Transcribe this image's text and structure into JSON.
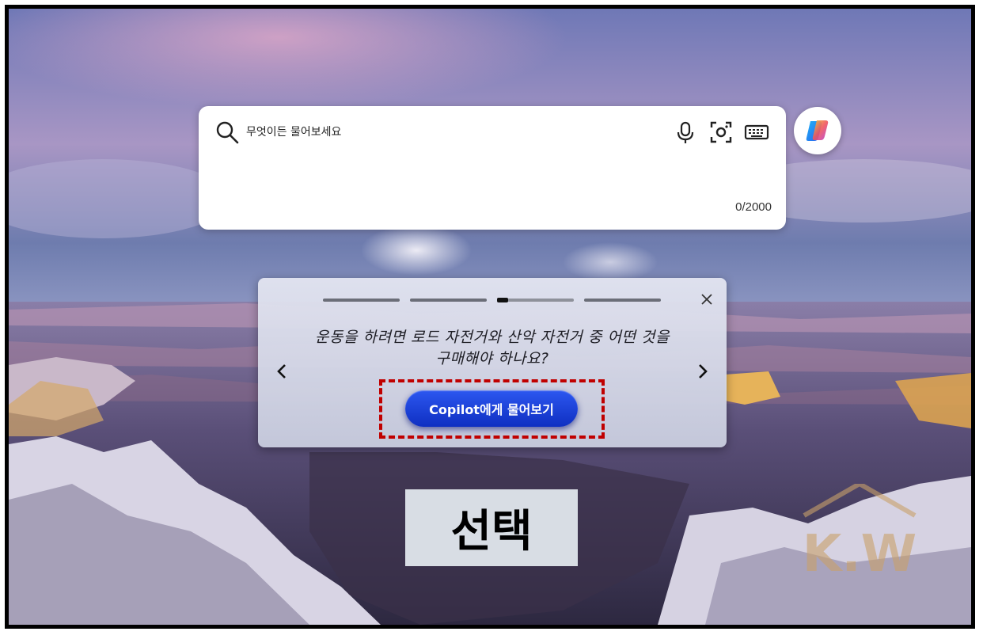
{
  "search": {
    "placeholder": "무엇이든 물어보세요",
    "char_count": "0/2000"
  },
  "icons": {
    "search": "search-icon",
    "microphone": "microphone-icon",
    "visual_search": "camera-lens-icon",
    "keyboard": "keyboard-icon",
    "copilot": "copilot-logo-icon",
    "close": "close-icon",
    "prev": "chevron-left-icon",
    "next": "chevron-right-icon"
  },
  "suggestion": {
    "progress": {
      "total": 4,
      "current": 3
    },
    "text": "운동을 하려면 로드 자전거와 산악 자전거 중 어떤 것을 구매해야 하나요?",
    "ask_label": "Copilot에게 물어보기"
  },
  "annotation": {
    "label": "선택",
    "highlight_color": "#c00000"
  },
  "watermark": {
    "text": "K.W"
  },
  "colors": {
    "ask_button": "#1a3fdc",
    "card_bg": "#dfe1ec"
  }
}
